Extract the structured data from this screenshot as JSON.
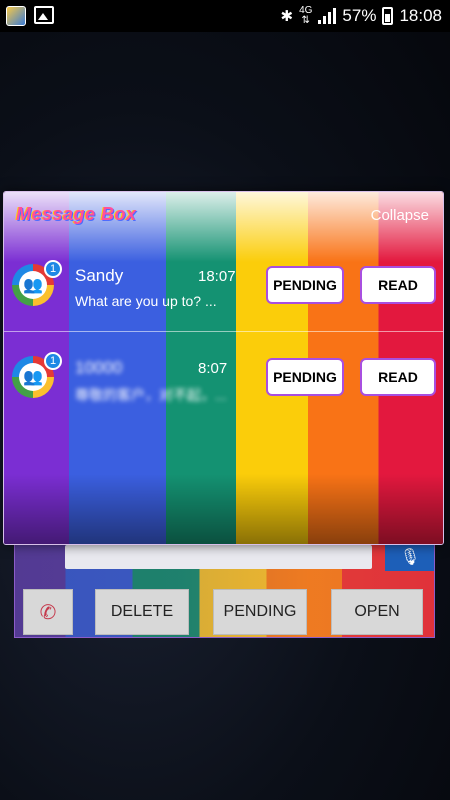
{
  "status_bar": {
    "icons_left": [
      "app-notification-icon",
      "gallery-icon"
    ],
    "icons_right": [
      "bluetooth-icon",
      "network-4g-icon",
      "signal-icon",
      "battery-icon"
    ],
    "network": "4G",
    "battery": "57%",
    "time": "18:08"
  },
  "message_box": {
    "title": "Message Box",
    "collapse": "Collapse",
    "messages": [
      {
        "sender": "Sandy",
        "time": "18:07",
        "preview": "What are you up to? ...",
        "badge": "1",
        "pending": "PENDING",
        "read": "READ"
      },
      {
        "sender": "10000",
        "time": "8:07",
        "preview": "尊敬的客户，对不起，...",
        "badge": "1",
        "pending": "PENDING",
        "read": "READ"
      }
    ]
  },
  "background_app": {
    "buttons": {
      "delete": "DELETE",
      "pending": "PENDING",
      "open": "OPEN"
    },
    "icons": [
      "phone-icon",
      "mic-icon"
    ]
  },
  "colors": {
    "stripe_purple": "#7b2ed3",
    "stripe_blue": "#3b5fe0",
    "stripe_green": "#149272",
    "stripe_yellow": "#fbcd0a",
    "stripe_orange": "#f97316",
    "stripe_red": "#e3183e"
  }
}
